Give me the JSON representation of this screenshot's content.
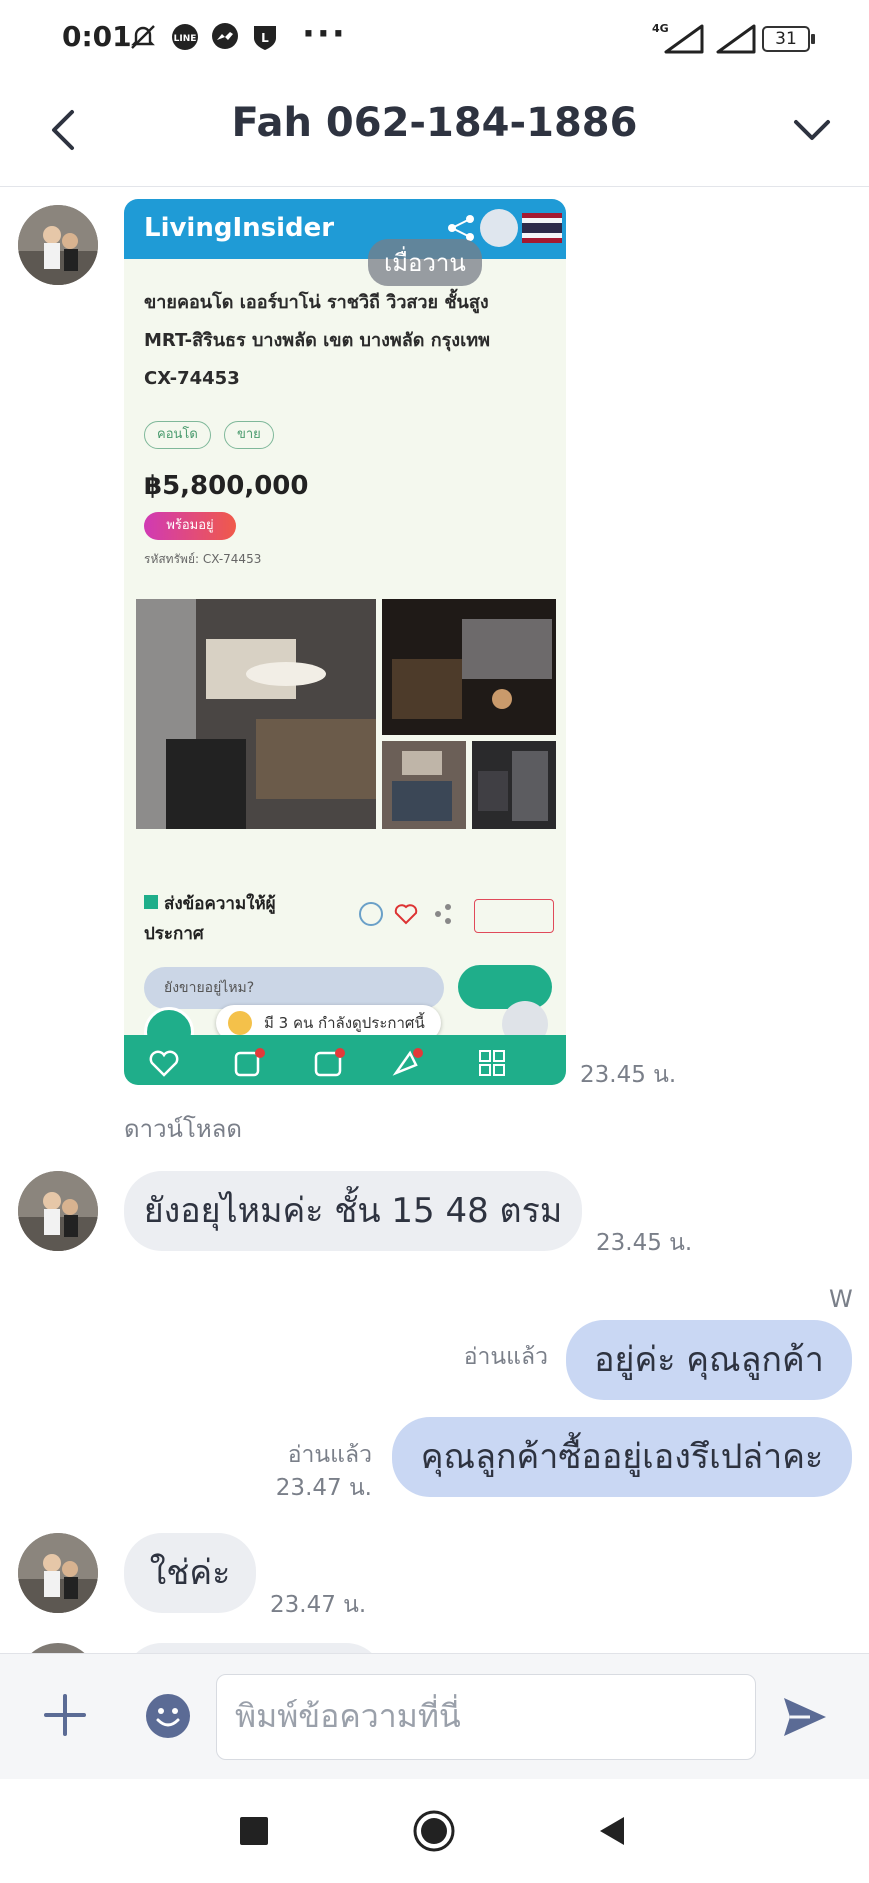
{
  "status": {
    "time": "0:01",
    "network": "4G",
    "battery": "31"
  },
  "header": {
    "title": "Fah 062-184-1886"
  },
  "chat": {
    "shared_screenshot": {
      "site": "LivingInsider",
      "yesterday_label": "เมื่อวาน",
      "listing_title_line1": "ขายคอนโด เออร์บาโน่ ราชวิถี วิวสวย ชั้นสูง",
      "listing_title_line2": "MRT-สิรินธร บางพลัด เขต บางพลัด กรุงเทพ",
      "listing_code": "CX-74453",
      "tag_condo": "คอนโด",
      "tag_sale": "ขาย",
      "price": "฿5,800,000",
      "status_pill": "พร้อมอยู่",
      "meta_code": "รหัสทรัพย์: CX-74453",
      "send_owner_line1": "ส่งข้อความให้ผู้",
      "send_owner_line2": "ประกาศ",
      "ask_placeholder": "ยังขายอยู่ไหม?",
      "viewers_text": "มี 3 คน กำลังดูประกาศนี้",
      "time": "23.45 น."
    },
    "download_label": "ดาวน์โหลด",
    "messages": [
      {
        "text": "ยังอยุไหมค่ะ ชั้น 15 48 ตรม",
        "time": "23.45 น."
      },
      {
        "sender_initial": "W",
        "text": "อยู่ค่ะ คุณลูกค้า",
        "read": "อ่านแล้ว"
      },
      {
        "text": "คุณลูกค้าซื้ออยู่เองรึเปล่าคะ",
        "read": "อ่านแล้ว",
        "time": "23.47 น."
      },
      {
        "text": "ใช่ค่ะ",
        "time": "23.47 น."
      }
    ]
  },
  "composer": {
    "placeholder": "พิมพ์ข้อความที่นี่"
  },
  "colors": {
    "outgoing_bubble": "#c9d7f3",
    "incoming_bubble": "#eceef2",
    "send_icon": "#5b6b95"
  }
}
